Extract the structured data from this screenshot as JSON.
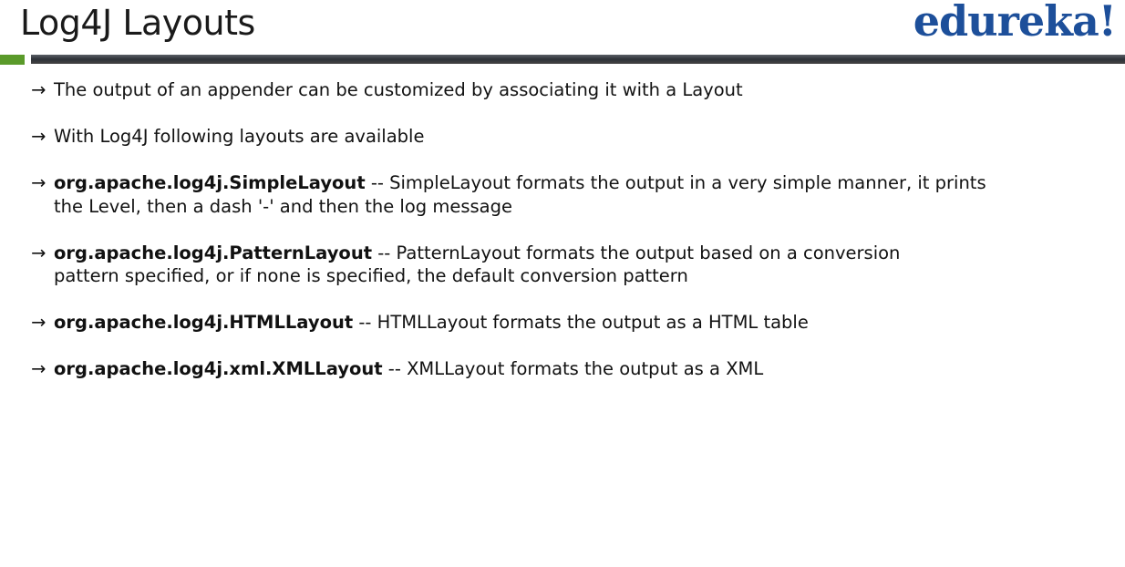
{
  "title": "Log4J Layouts",
  "logo": "edureka!",
  "colors": {
    "accent_green": "#5a9a2a",
    "logo_blue": "#1d4f9a",
    "bar_dark": "#2e3238"
  },
  "bullet_icon": "right-arrow-icon",
  "bullets": [
    {
      "bold": "",
      "text": "The output of an appender can be customized by associating it with  a Layout"
    },
    {
      "bold": "",
      "text": "With Log4J following layouts are available"
    },
    {
      "bold": "org.apache.log4j.SimpleLayout",
      "text": " -- SimpleLayout formats the output in a very simple manner, it prints the Level, then a dash '-' and then the log message"
    },
    {
      "bold": "org.apache.log4j.PatternLayout",
      "text": " -- PatternLayout formats the output based on a conversion pattern specified, or if none is specified, the default conversion pattern"
    },
    {
      "bold": "org.apache.log4j.HTMLLayout",
      "text": " --  HTMLLayout formats the output as a HTML table"
    },
    {
      "bold": "org.apache.log4j.xml.XMLLayout",
      "text": " -- XMLLayout formats the output as a XML"
    }
  ]
}
